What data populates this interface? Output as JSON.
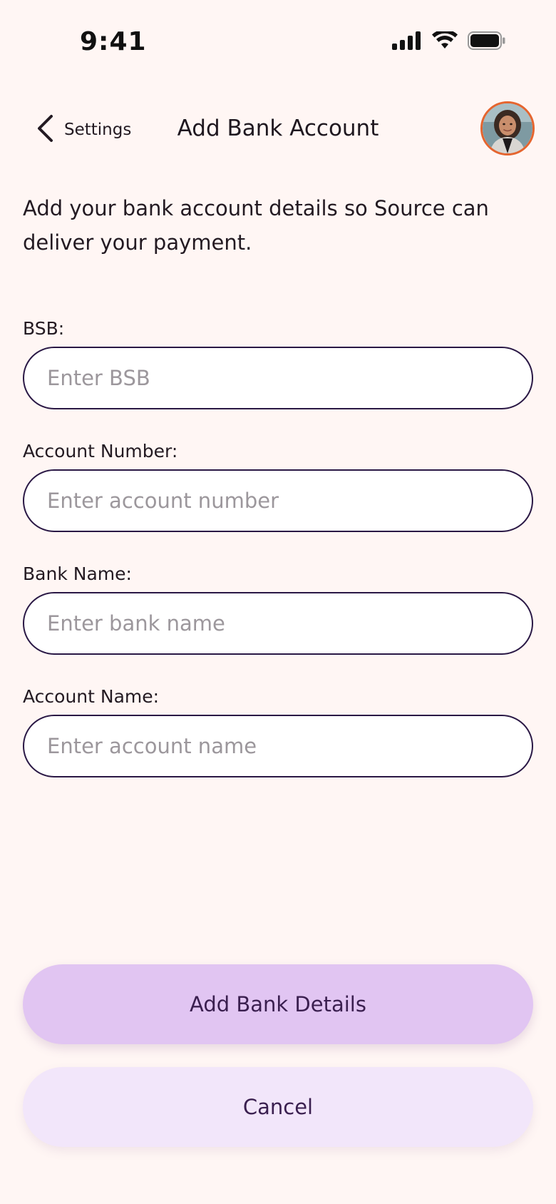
{
  "status_bar": {
    "time": "9:41",
    "icons": [
      "signal-icon",
      "wifi-icon",
      "battery-icon"
    ]
  },
  "nav": {
    "back_label": "Settings",
    "back_icon": "chevron-left-icon",
    "title": "Add Bank Account",
    "avatar": "avatar"
  },
  "intro": "Add your bank account details so Source can deliver your payment.",
  "form": {
    "bsb": {
      "label": "BSB:",
      "placeholder": "Enter BSB",
      "value": ""
    },
    "account_number": {
      "label": "Account Number:",
      "placeholder": "Enter account number",
      "value": ""
    },
    "bank_name": {
      "label": "Bank Name:",
      "placeholder": "Enter bank name",
      "value": ""
    },
    "account_name": {
      "label": "Account Name:",
      "placeholder": "Enter account name",
      "value": ""
    }
  },
  "actions": {
    "primary_label": "Add Bank Details",
    "secondary_label": "Cancel"
  },
  "colors": {
    "background": "#FFF6F4",
    "input_border": "#2A1845",
    "primary_button": "#E1C5F2",
    "secondary_button": "#F2E6FA",
    "button_text": "#3A1F4F",
    "avatar_ring": "#E5652F"
  }
}
